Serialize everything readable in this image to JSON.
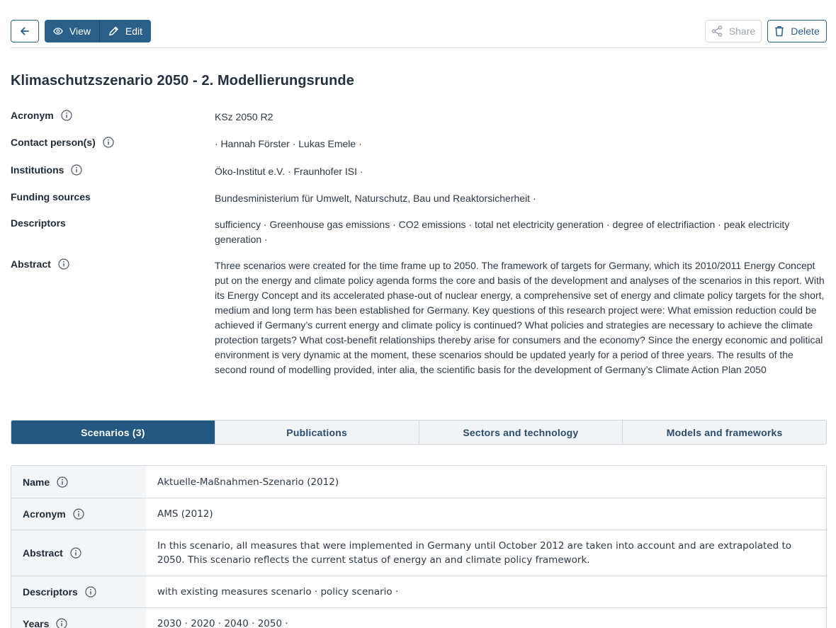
{
  "toolbar": {
    "back_icon": "arrow-left-icon",
    "view_label": "View",
    "view_icon": "eye-icon",
    "edit_label": "Edit",
    "edit_icon": "pencil-icon",
    "share_label": "Share",
    "share_icon": "share-icon",
    "delete_label": "Delete",
    "delete_icon": "trash-icon",
    "accent_color": "#2a5f8a"
  },
  "title": "Klimaschutzszenario 2050 - 2. Modellierungsrunde",
  "fields": {
    "acronym": {
      "label": "Acronym",
      "value": "KSz 2050 R2"
    },
    "contacts": {
      "label": "Contact person(s)",
      "value": "· Hannah Förster · Lukas Emele ·"
    },
    "institutions": {
      "label": "Institutions",
      "value": "Öko-Institut e.V. · Fraunhofer ISI ·"
    },
    "funding": {
      "label": "Funding sources",
      "value": "Bundesministerium für Umwelt, Naturschutz, Bau und Reaktorsicherheit ·"
    },
    "descriptors": {
      "label": "Descriptors",
      "value": "sufficiency · Greenhouse gas emissions · CO2 emissions · total net electricity generation · degree of electrifiaction · peak electricity generation ·"
    },
    "abstract": {
      "label": "Abstract",
      "value": "Three scenarios were created for the time frame up to 2050. The framework of targets for Germany, which its 2010/2011 Energy Concept put on the energy and climate policy agenda forms the core and basis of the development and analyses of the scenarios in this report. With its Energy Concept and its accelerated phase-out of nuclear energy, a comprehensive set of energy and climate policy targets for the short, medium and long term has been established for Germany. Key questions of this research project were: What emission reduction could be achieved if Germany’s current energy and climate policy is continued? What policies and strategies are necessary to achieve the climate protection targets? What cost-benefit relationships thereby arise for consumers and the economy? Since the energy economic and political environment is very dynamic at the moment, these scenarios should be updated yearly for a period of three years. The results of the second round of modelling provided, inter alia, the scientific basis for the development of Germany’s Climate Action Plan 2050"
    }
  },
  "tabs": [
    {
      "label": "Scenarios (3)",
      "active": true
    },
    {
      "label": "Publications",
      "active": false
    },
    {
      "label": "Sectors and technology",
      "active": false
    },
    {
      "label": "Models and frameworks",
      "active": false
    }
  ],
  "scenario": {
    "name": {
      "label": "Name",
      "value": "Aktuelle-Maßnahmen-Szenario (2012)"
    },
    "acronym": {
      "label": "Acronym",
      "value": "AMS (2012)"
    },
    "abstract": {
      "label": "Abstract",
      "value": "In this scenario, all measures that were implemented in Germany until October 2012 are taken into account and are extrapolated to 2050. This scenario reflects the current status of energy an and climate policy framework."
    },
    "descriptors": {
      "label": "Descriptors",
      "value": "with existing measures scenario · policy scenario ·"
    },
    "years": {
      "label": "Years",
      "value": "2030 · 2020 · 2040 · 2050 ·"
    }
  }
}
